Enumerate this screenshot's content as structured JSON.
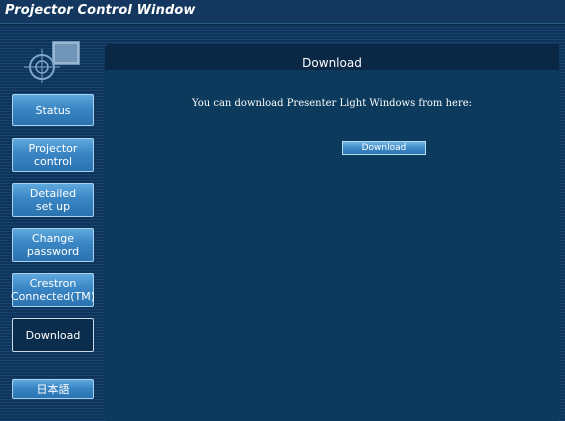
{
  "window": {
    "title": "Projector Control Window"
  },
  "sidebar": {
    "items": [
      {
        "label": "Status"
      },
      {
        "label": "Projector\ncontrol"
      },
      {
        "label": "Detailed\nset up"
      },
      {
        "label": "Change\npassword"
      },
      {
        "label": "Crestron\nConnected(TM)"
      },
      {
        "label": "Download"
      },
      {
        "label": "日本語"
      }
    ]
  },
  "main": {
    "title": "Download",
    "description": "You can download Presenter Light Windows from here:",
    "download_button": "Download"
  }
}
